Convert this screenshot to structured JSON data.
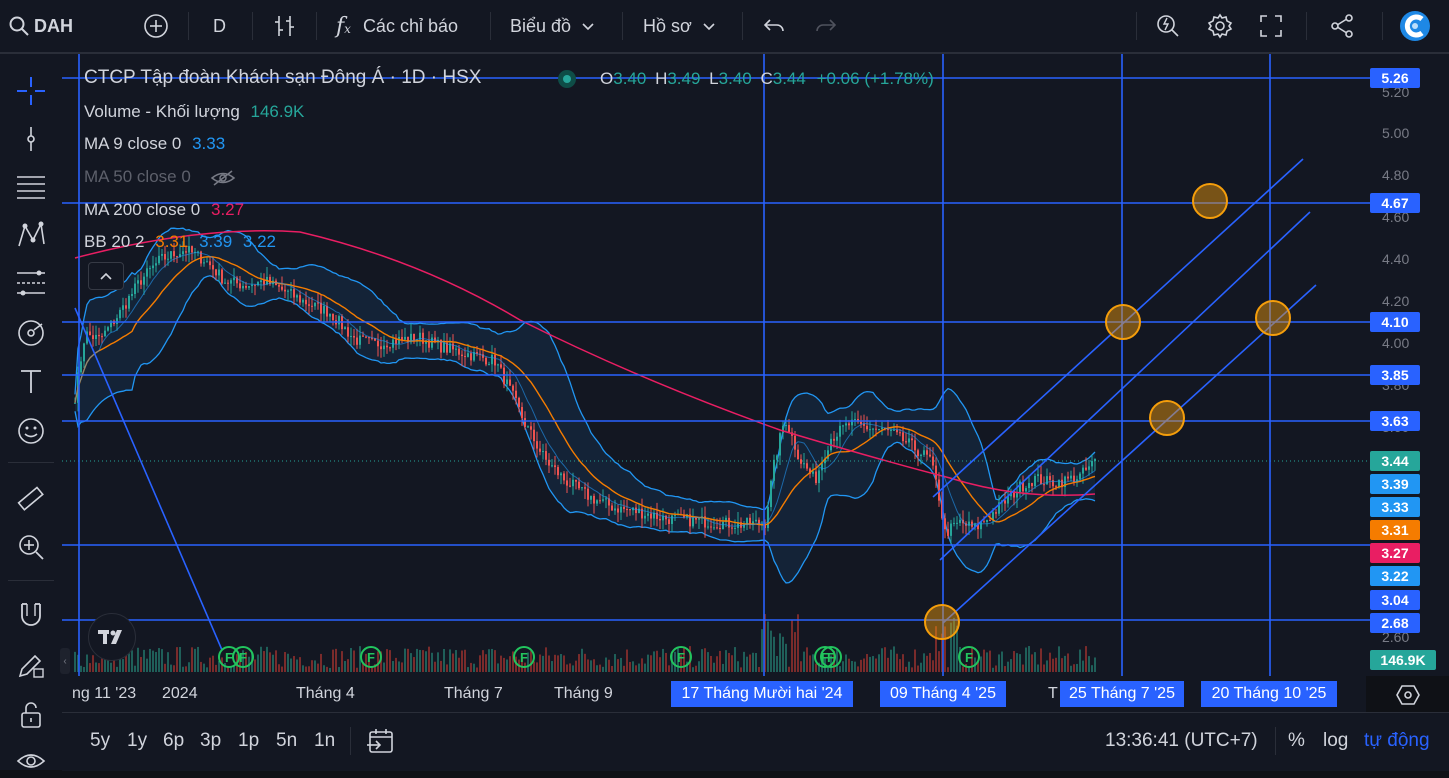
{
  "toolbar": {
    "symbol": "DAH",
    "interval": "D",
    "indicators_label": "Các chỉ báo",
    "chart_menu_label": "Biểu đồ",
    "profile_menu_label": "Hồ sơ"
  },
  "legend": {
    "title": "CTCP Tập đoàn Khách sạn Đông Á · 1D · HSX",
    "ohlc": {
      "o_label": "O",
      "o": "3.40",
      "h_label": "H",
      "h": "3.49",
      "l_label": "L",
      "l": "3.40",
      "c_label": "C",
      "c": "3.44",
      "change": "+0.06 (+1.78%)"
    },
    "volume": {
      "name": "Volume - Khối lượng",
      "value": "146.9K"
    },
    "ma9": {
      "name": "MA 9 close 0",
      "value": "3.33"
    },
    "ma50": {
      "name": "MA 50 close 0"
    },
    "ma200": {
      "name": "MA 200 close 0",
      "value": "3.27"
    },
    "bb": {
      "name": "BB 20 2",
      "v1": "3.31",
      "v2": "3.39",
      "v3": "3.22"
    }
  },
  "price_axis": {
    "ticks": [
      "5.20",
      "5.00",
      "4.80",
      "4.60",
      "4.40",
      "4.20",
      "4.00",
      "3.80",
      "3.60",
      "2.60"
    ],
    "labels": [
      {
        "value": "5.26",
        "color": "#2962ff"
      },
      {
        "value": "4.67",
        "color": "#2962ff"
      },
      {
        "value": "4.10",
        "color": "#2962ff"
      },
      {
        "value": "3.85",
        "color": "#2962ff"
      },
      {
        "value": "3.63",
        "color": "#2962ff"
      },
      {
        "value": "3.44",
        "color": "#26a69a"
      },
      {
        "value": "3.39",
        "color": "#2196f3"
      },
      {
        "value": "3.33",
        "color": "#2196f3"
      },
      {
        "value": "3.31",
        "color": "#f57c00"
      },
      {
        "value": "3.27",
        "color": "#e91e63"
      },
      {
        "value": "3.22",
        "color": "#2196f3"
      },
      {
        "value": "3.04",
        "color": "#2962ff"
      },
      {
        "value": "2.68",
        "color": "#2962ff"
      },
      {
        "value": "146.9K",
        "color": "#26a69a"
      }
    ]
  },
  "time_axis": {
    "labels": [
      "ng 11 '23",
      "2024",
      "Tháng 4",
      "Tháng 7",
      "Tháng 9",
      "T"
    ],
    "highlighted": [
      "17 Tháng Mười hai '24",
      "09 Tháng 4 '25",
      "25 Tháng 7 '25",
      "20 Tháng 10 '25"
    ]
  },
  "events": {
    "dividend_badge": "F"
  },
  "bottom": {
    "ranges": [
      "5y",
      "1y",
      "6p",
      "3p",
      "1p",
      "5n",
      "1n"
    ],
    "time": "13:36:41 (UTC+7)",
    "percent": "%",
    "log": "log",
    "auto": "tự động"
  },
  "colors": {
    "background": "#131722",
    "up": "#26a69a",
    "down": "#ef5350",
    "ma9": "#2196f3",
    "ma200": "#e91e63",
    "bb_basis": "#f57c00",
    "drawings": "#2962ff",
    "markers": "#f59e0b"
  }
}
